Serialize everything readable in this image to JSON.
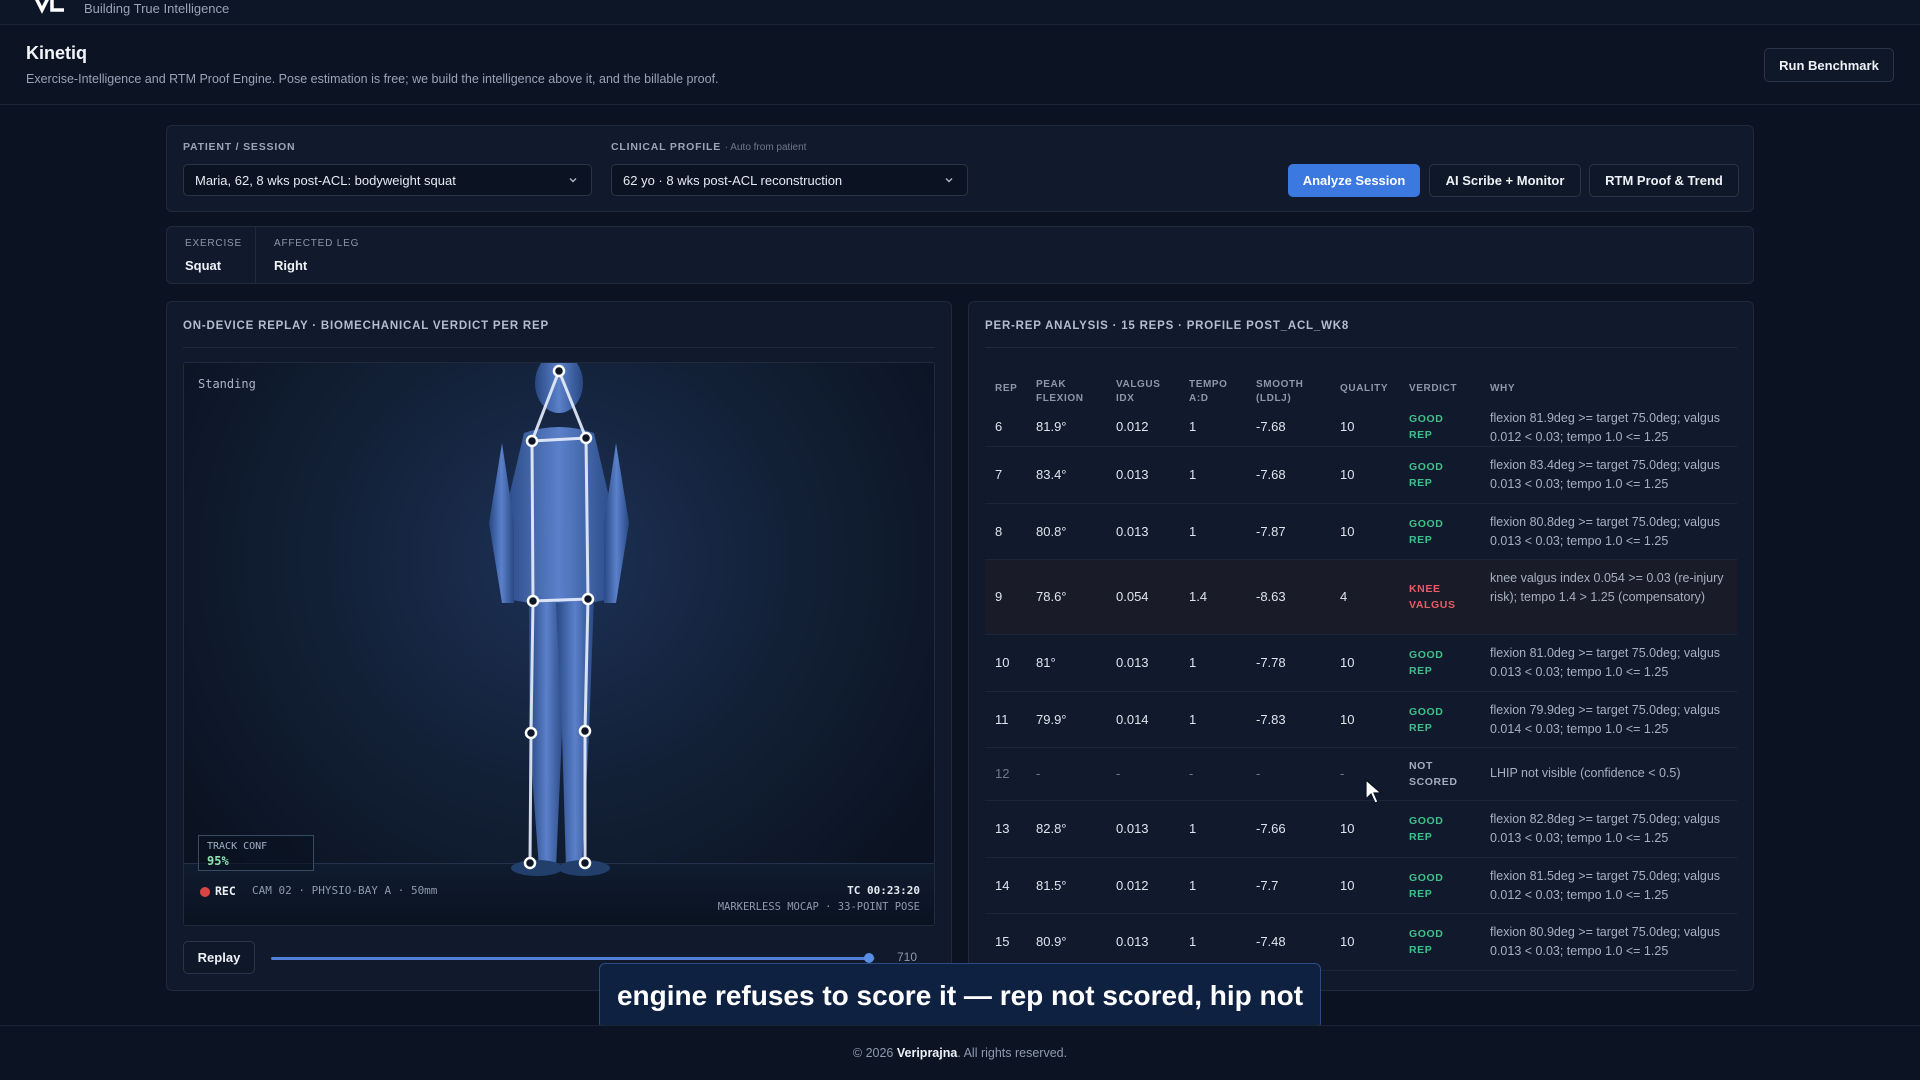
{
  "brand": {
    "tagline": "Building True Intelligence"
  },
  "header": {
    "title": "Kinetiq",
    "subtitle": "Exercise-Intelligence and RTM Proof Engine. Pose estimation is free; we build the intelligence above it, and the billable proof.",
    "benchmark_label": "Run Benchmark"
  },
  "session": {
    "patient_label": "PATIENT / SESSION",
    "patient_value": "Maria, 62, 8 wks post-ACL: bodyweight squat",
    "profile_label": "CLINICAL PROFILE",
    "profile_hint": "· Auto from patient",
    "profile_value": "62 yo · 8 wks post-ACL reconstruction",
    "analyze_label": "Analyze Session",
    "scribe_label": "AI Scribe + Monitor",
    "rtm_label": "RTM Proof & Trend"
  },
  "exercise": {
    "exercise_label": "EXERCISE",
    "exercise_value": "Squat",
    "leg_label": "AFFECTED LEG",
    "leg_value": "Right"
  },
  "replay": {
    "title": "ON-DEVICE REPLAY · BIOMECHANICAL VERDICT PER REP",
    "pose_state": "Standing",
    "track_conf_label": "TRACK CONF",
    "track_conf_value": "95%",
    "rec_label": "REC",
    "camera_label": "CAM 02 · PHYSIO-BAY A · 50mm",
    "timecode": "TC 00:23:20",
    "mocap_label": "MARKERLESS MOCAP · 33-POINT POSE",
    "replay_button": "Replay",
    "frame": "710",
    "progress": 0.99
  },
  "analysis": {
    "title": "PER-REP ANALYSIS · 15 REPS · PROFILE POST_ACL_WK8",
    "columns": {
      "rep": "REP",
      "flex1": "PEAK",
      "flex2": "FLEXION",
      "valgus1": "VALGUS",
      "valgus2": "IDX",
      "tempo1": "TEMPO",
      "tempo2": "A:D",
      "smooth1": "SMOOTH",
      "smooth2": "(LDLJ)",
      "quality": "QUALITY",
      "verdict": "VERDICT",
      "why": "WHY"
    },
    "rows": [
      {
        "rep": "6",
        "flexion": "81.9°",
        "valgus": "0.012",
        "tempo": "1",
        "smooth": "-7.68",
        "quality": "10",
        "verdict_1": "GOOD",
        "verdict_2": "REP",
        "why": "flexion 81.9deg >= target 75.0deg; valgus 0.012 < 0.03; tempo 1.0 <= 1.25"
      },
      {
        "rep": "7",
        "flexion": "83.4°",
        "valgus": "0.013",
        "tempo": "1",
        "smooth": "-7.68",
        "quality": "10",
        "verdict_1": "GOOD",
        "verdict_2": "REP",
        "why": "flexion 83.4deg >= target 75.0deg; valgus 0.013 < 0.03; tempo 1.0 <= 1.25"
      },
      {
        "rep": "8",
        "flexion": "80.8°",
        "valgus": "0.013",
        "tempo": "1",
        "smooth": "-7.87",
        "quality": "10",
        "verdict_1": "GOOD",
        "verdict_2": "REP",
        "why": "flexion 80.8deg >= target 75.0deg; valgus 0.013 < 0.03; tempo 1.0 <= 1.25"
      },
      {
        "rep": "9",
        "flexion": "78.6°",
        "valgus": "0.054",
        "tempo": "1.4",
        "smooth": "-8.63",
        "quality": "4",
        "verdict_1": "KNEE",
        "verdict_2": "VALGUS",
        "why": "knee valgus index 0.054 >= 0.03 (re-injury risk); tempo 1.4 > 1.25 (compensatory)"
      },
      {
        "rep": "10",
        "flexion": "81°",
        "valgus": "0.013",
        "tempo": "1",
        "smooth": "-7.78",
        "quality": "10",
        "verdict_1": "GOOD",
        "verdict_2": "REP",
        "why": "flexion 81.0deg >= target 75.0deg; valgus 0.013 < 0.03; tempo 1.0 <= 1.25"
      },
      {
        "rep": "11",
        "flexion": "79.9°",
        "valgus": "0.014",
        "tempo": "1",
        "smooth": "-7.83",
        "quality": "10",
        "verdict_1": "GOOD",
        "verdict_2": "REP",
        "why": "flexion 79.9deg >= target 75.0deg; valgus 0.014 < 0.03; tempo 1.0 <= 1.25"
      },
      {
        "rep": "12",
        "flexion": "-",
        "valgus": "-",
        "tempo": "-",
        "smooth": "-",
        "quality": "-",
        "verdict_1": "NOT",
        "verdict_2": "SCORED",
        "why": "LHIP not visible (confidence < 0.5)"
      },
      {
        "rep": "13",
        "flexion": "82.8°",
        "valgus": "0.013",
        "tempo": "1",
        "smooth": "-7.66",
        "quality": "10",
        "verdict_1": "GOOD",
        "verdict_2": "REP",
        "why": "flexion 82.8deg >= target 75.0deg; valgus 0.013 < 0.03; tempo 1.0 <= 1.25"
      },
      {
        "rep": "14",
        "flexion": "81.5°",
        "valgus": "0.012",
        "tempo": "1",
        "smooth": "-7.7",
        "quality": "10",
        "verdict_1": "GOOD",
        "verdict_2": "REP",
        "why": "flexion 81.5deg >= target 75.0deg; valgus 0.012 < 0.03; tempo 1.0 <= 1.25"
      },
      {
        "rep": "15",
        "flexion": "80.9°",
        "valgus": "0.013",
        "tempo": "1",
        "smooth": "-7.48",
        "quality": "10",
        "verdict_1": "GOOD",
        "verdict_2": "REP",
        "why": "flexion 80.9deg >= target 75.0deg; valgus 0.013 < 0.03; tempo 1.0 <= 1.25"
      }
    ]
  },
  "caption": "engine refuses to score it — rep not scored, hip not",
  "footer": {
    "prefix": "© 2026",
    "brand": "Veriprajna",
    "suffix": ". All rights reserved."
  },
  "colors": {
    "accent": "#3b78e0",
    "good": "#3fc08a",
    "bad": "#ea5b66",
    "background": "#0b1322"
  }
}
